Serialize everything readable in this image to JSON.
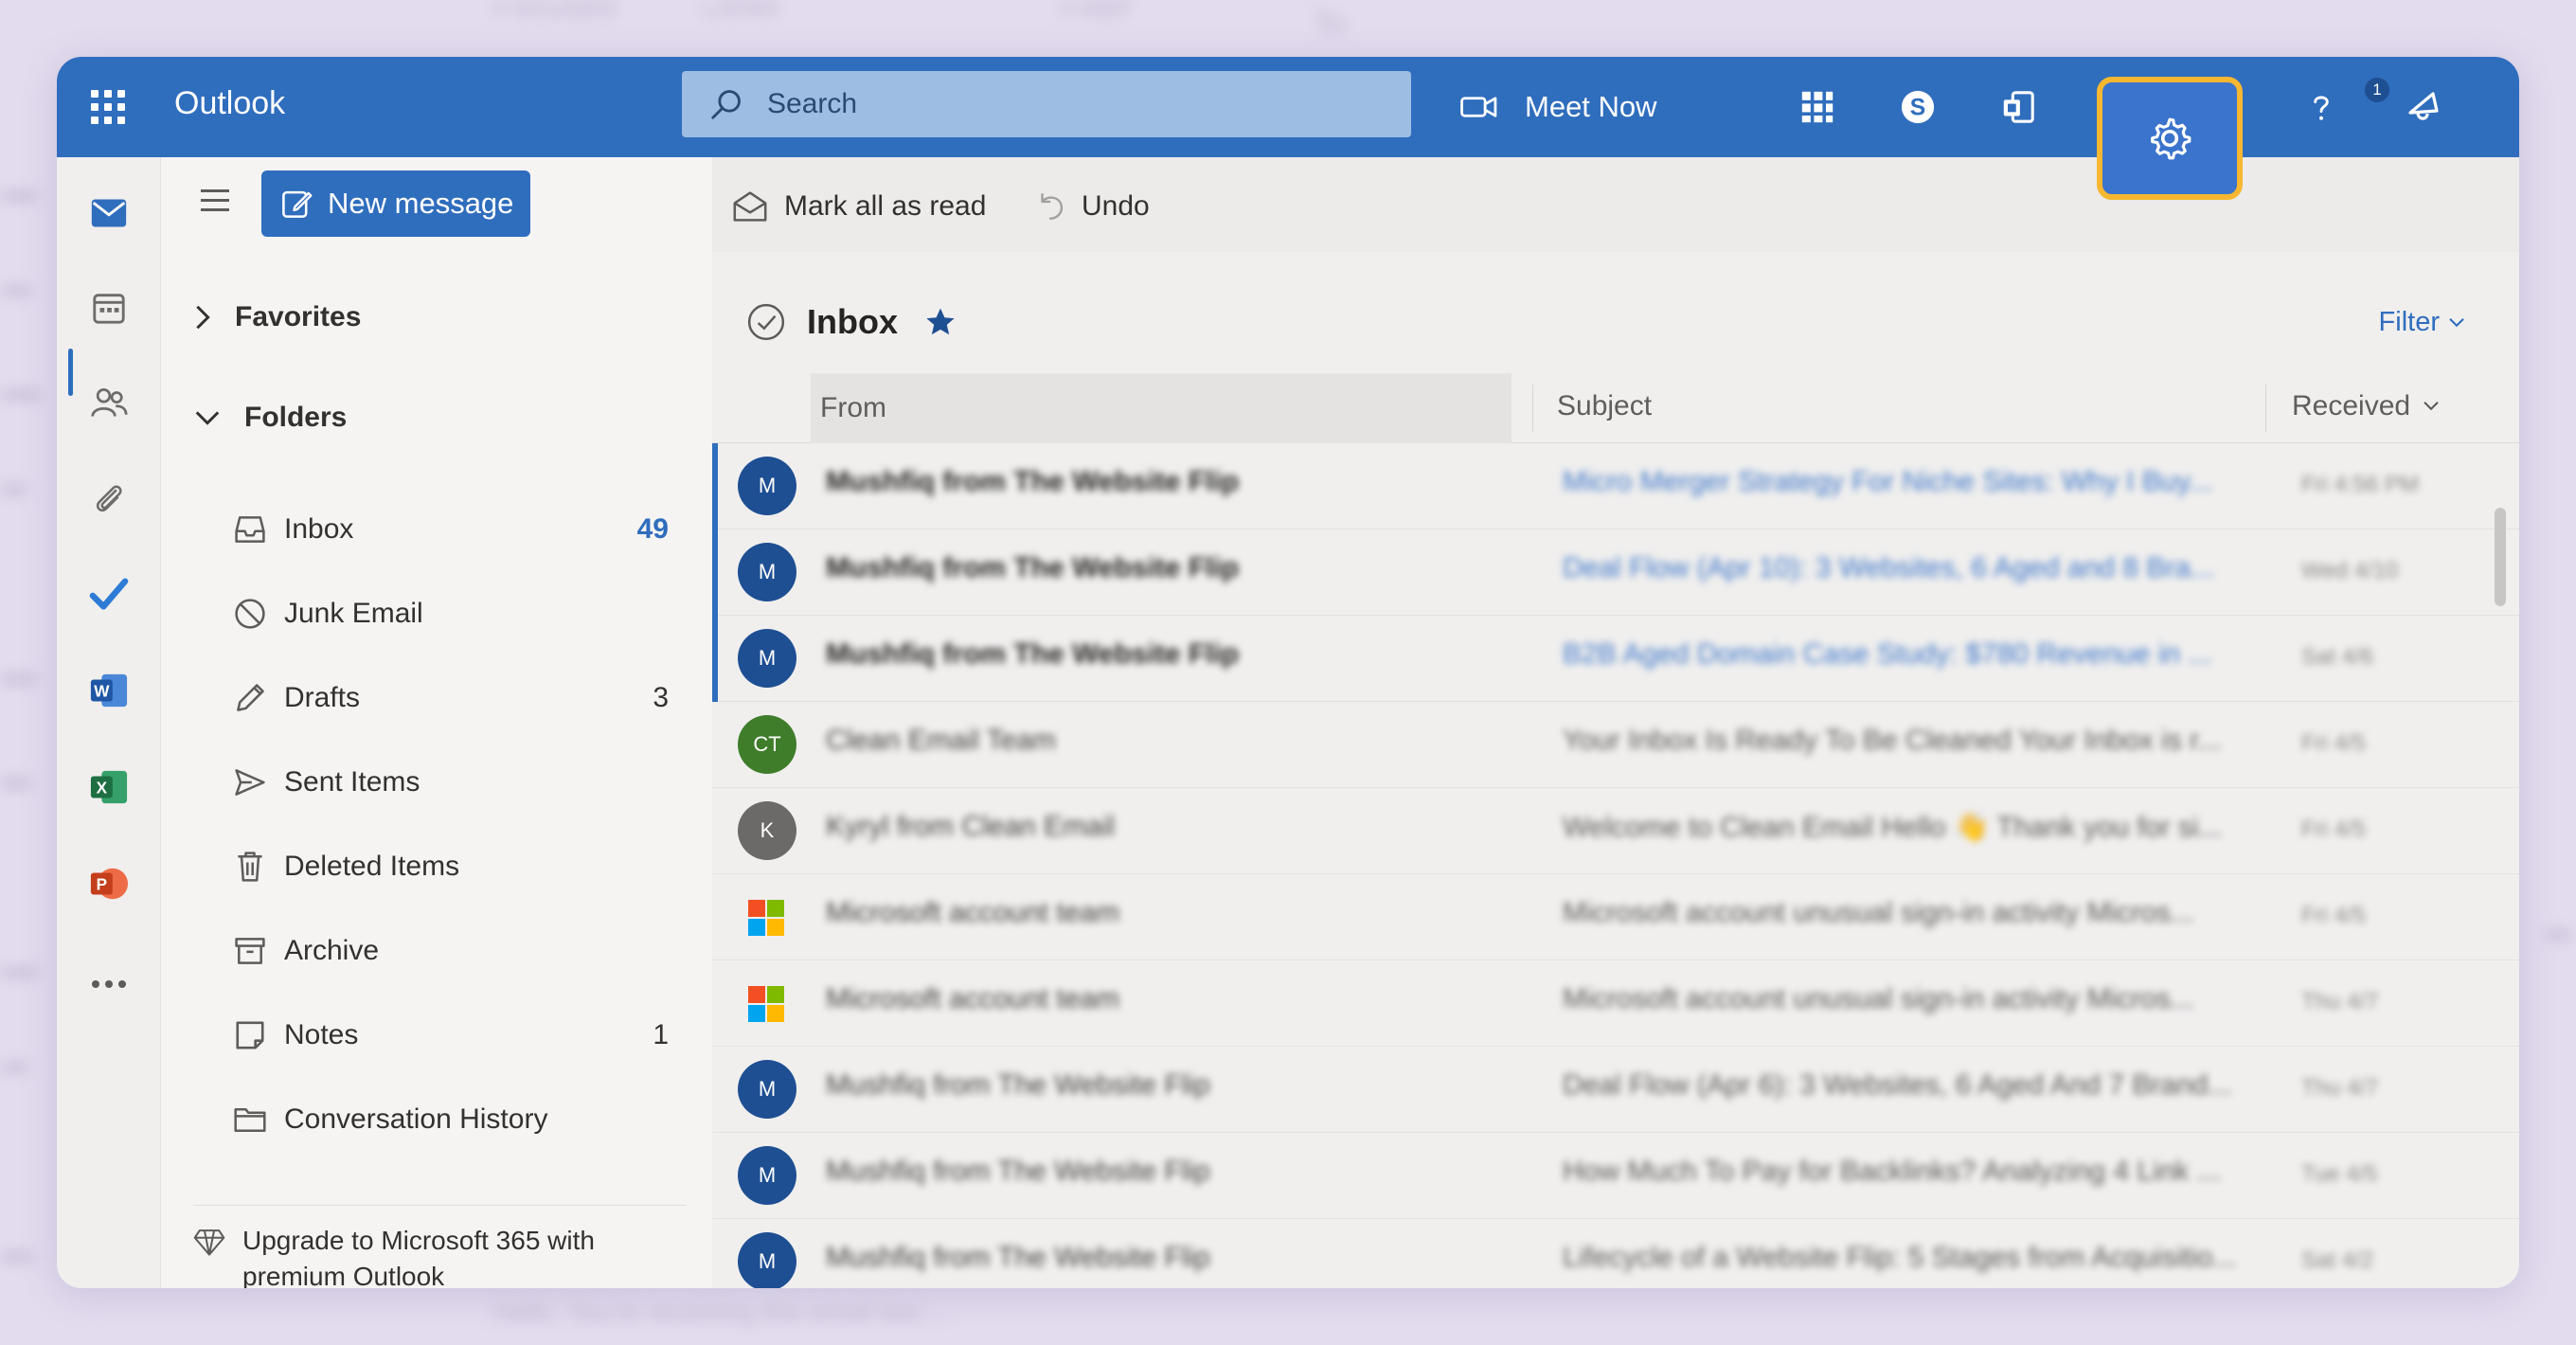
{
  "app": {
    "title": "Outlook"
  },
  "search": {
    "placeholder": "Search"
  },
  "topbar": {
    "meet_now": "Meet Now",
    "notification_count": "1"
  },
  "commands": {
    "new_message": "New message",
    "mark_all_read": "Mark all as read",
    "undo": "Undo"
  },
  "nav": {
    "favorites": "Favorites",
    "folders": "Folders",
    "items": [
      {
        "label": "Inbox",
        "count": "49"
      },
      {
        "label": "Junk Email",
        "count": ""
      },
      {
        "label": "Drafts",
        "count": "3"
      },
      {
        "label": "Sent Items",
        "count": ""
      },
      {
        "label": "Deleted Items",
        "count": ""
      },
      {
        "label": "Archive",
        "count": ""
      },
      {
        "label": "Notes",
        "count": "1"
      },
      {
        "label": "Conversation History",
        "count": ""
      }
    ],
    "upgrade": "Upgrade to Microsoft 365 with premium Outlook"
  },
  "inbox": {
    "title": "Inbox",
    "filter": "Filter",
    "columns": {
      "from": "From",
      "subject": "Subject",
      "received": "Received"
    }
  },
  "messages": [
    {
      "avatar": "M",
      "color": "#1e4f93",
      "from": "Mushfiq from The Website Flip",
      "subject": "Micro Merger Strategy For Niche Sites: Why I Buy...",
      "date": "Fri 4:56 PM",
      "unread": true
    },
    {
      "avatar": "M",
      "color": "#1e4f93",
      "from": "Mushfiq from The Website Flip",
      "subject": "Deal Flow (Apr 10): 3 Websites, 6 Aged and 8 Bra...",
      "date": "Wed 4/10",
      "unread": true
    },
    {
      "avatar": "M",
      "color": "#1e4f93",
      "from": "Mushfiq from The Website Flip",
      "subject": "B2B Aged Domain Case Study: $780 Revenue in ...",
      "date": "Sat 4/6",
      "unread": true
    },
    {
      "avatar": "CT",
      "color": "#3f7d2a",
      "from": "Clean Email Team",
      "subject": "Your Inbox Is Ready To Be Cleaned   Your Inbox is r...",
      "date": "Fri 4/5",
      "unread": false
    },
    {
      "avatar": "K",
      "color": "#6c6a68",
      "from": "Kyryl from Clean Email",
      "subject": "Welcome to Clean Email   Hello 👋 Thank you for si...",
      "date": "Fri 4/5",
      "unread": false
    },
    {
      "avatar": "ms",
      "color": "",
      "from": "Microsoft account team",
      "subject": "Microsoft account unusual sign-in activity   Micros...",
      "date": "Fri 4/5",
      "unread": false
    },
    {
      "avatar": "ms",
      "color": "",
      "from": "Microsoft account team",
      "subject": "Microsoft account unusual sign-in activity   Micros...",
      "date": "Thu 4/7",
      "unread": false
    },
    {
      "avatar": "M",
      "color": "#1e4f93",
      "from": "Mushfiq from The Website Flip",
      "subject": "Deal Flow (Apr 6): 3 Websites, 6 Aged And 7 Brand...",
      "date": "Thu 4/7",
      "unread": false
    },
    {
      "avatar": "M",
      "color": "#1e4f93",
      "from": "Mushfiq from The Website Flip",
      "subject": "How Much To Pay for Backlinks? Analyzing 4 Link ...",
      "date": "Tue 4/5",
      "unread": false
    },
    {
      "avatar": "M",
      "color": "#1e4f93",
      "from": "Mushfiq from The Website Flip",
      "subject": "Lifecycle of a Website Flip: 5 Stages from Acquisitio...",
      "date": "Sat 4/2",
      "unread": false
    }
  ],
  "background": {
    "tabs": [
      "Focused",
      "Other"
    ],
    "filter": "Filter",
    "to": "To",
    "preview": "Hello, You're receiving this email bec..."
  }
}
